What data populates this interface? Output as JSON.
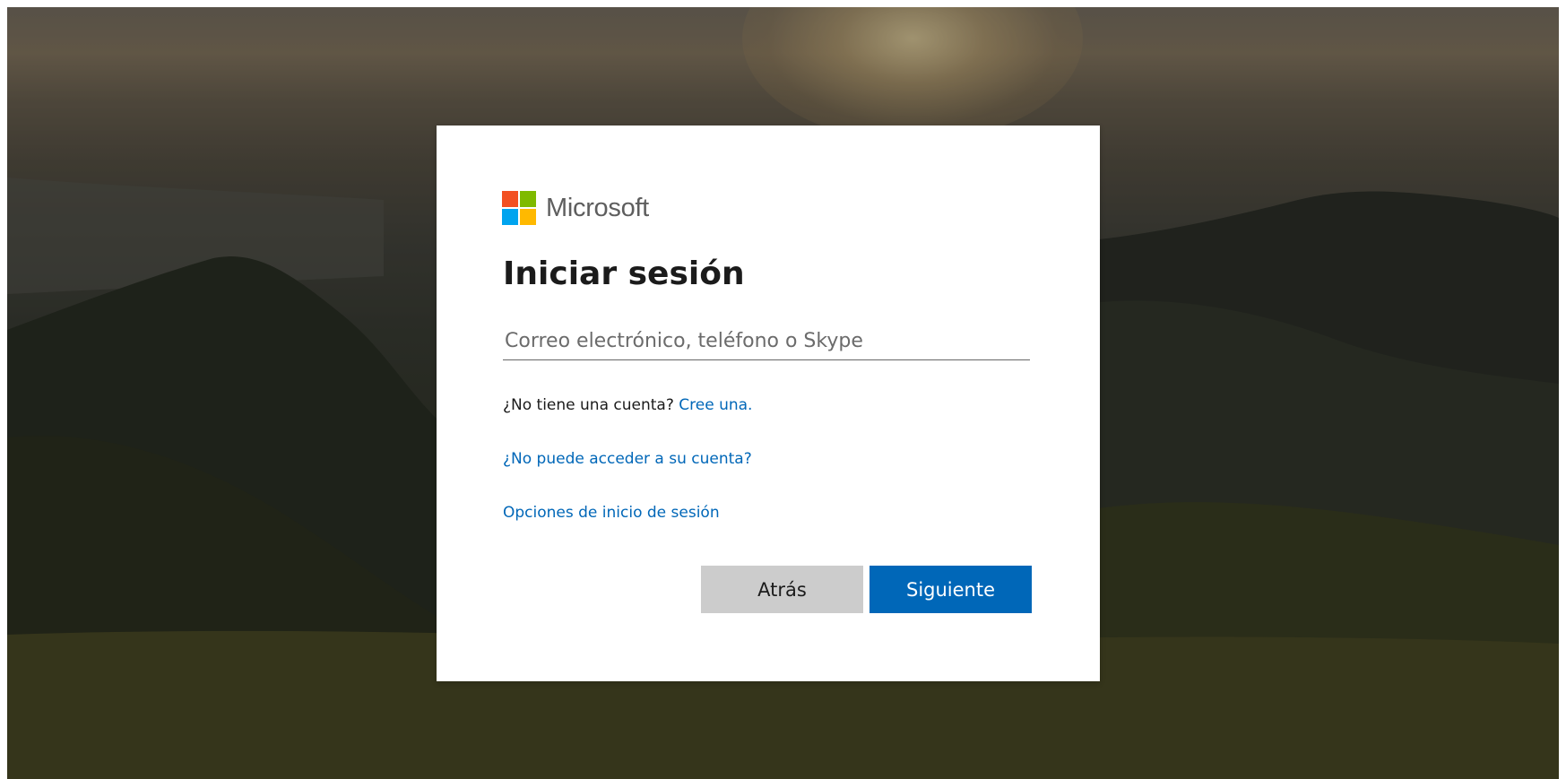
{
  "brand": {
    "name": "Microsoft",
    "logo_colors": [
      "#f25022",
      "#7fba00",
      "#00a4ef",
      "#ffb900"
    ]
  },
  "signin": {
    "title": "Iniciar sesión",
    "email_placeholder": "Correo electrónico, teléfono o Skype",
    "email_value": "",
    "no_account_text": "¿No tiene una cuenta?",
    "create_link": "Cree una.",
    "cant_access_link": "¿No puede acceder a su cuenta?",
    "signin_options_link": "Opciones de inicio de sesión",
    "back_button": "Atrás",
    "next_button": "Siguiente"
  },
  "colors": {
    "accent": "#0067b8",
    "back_button_bg": "#cccccc",
    "card_bg": "#ffffff"
  }
}
